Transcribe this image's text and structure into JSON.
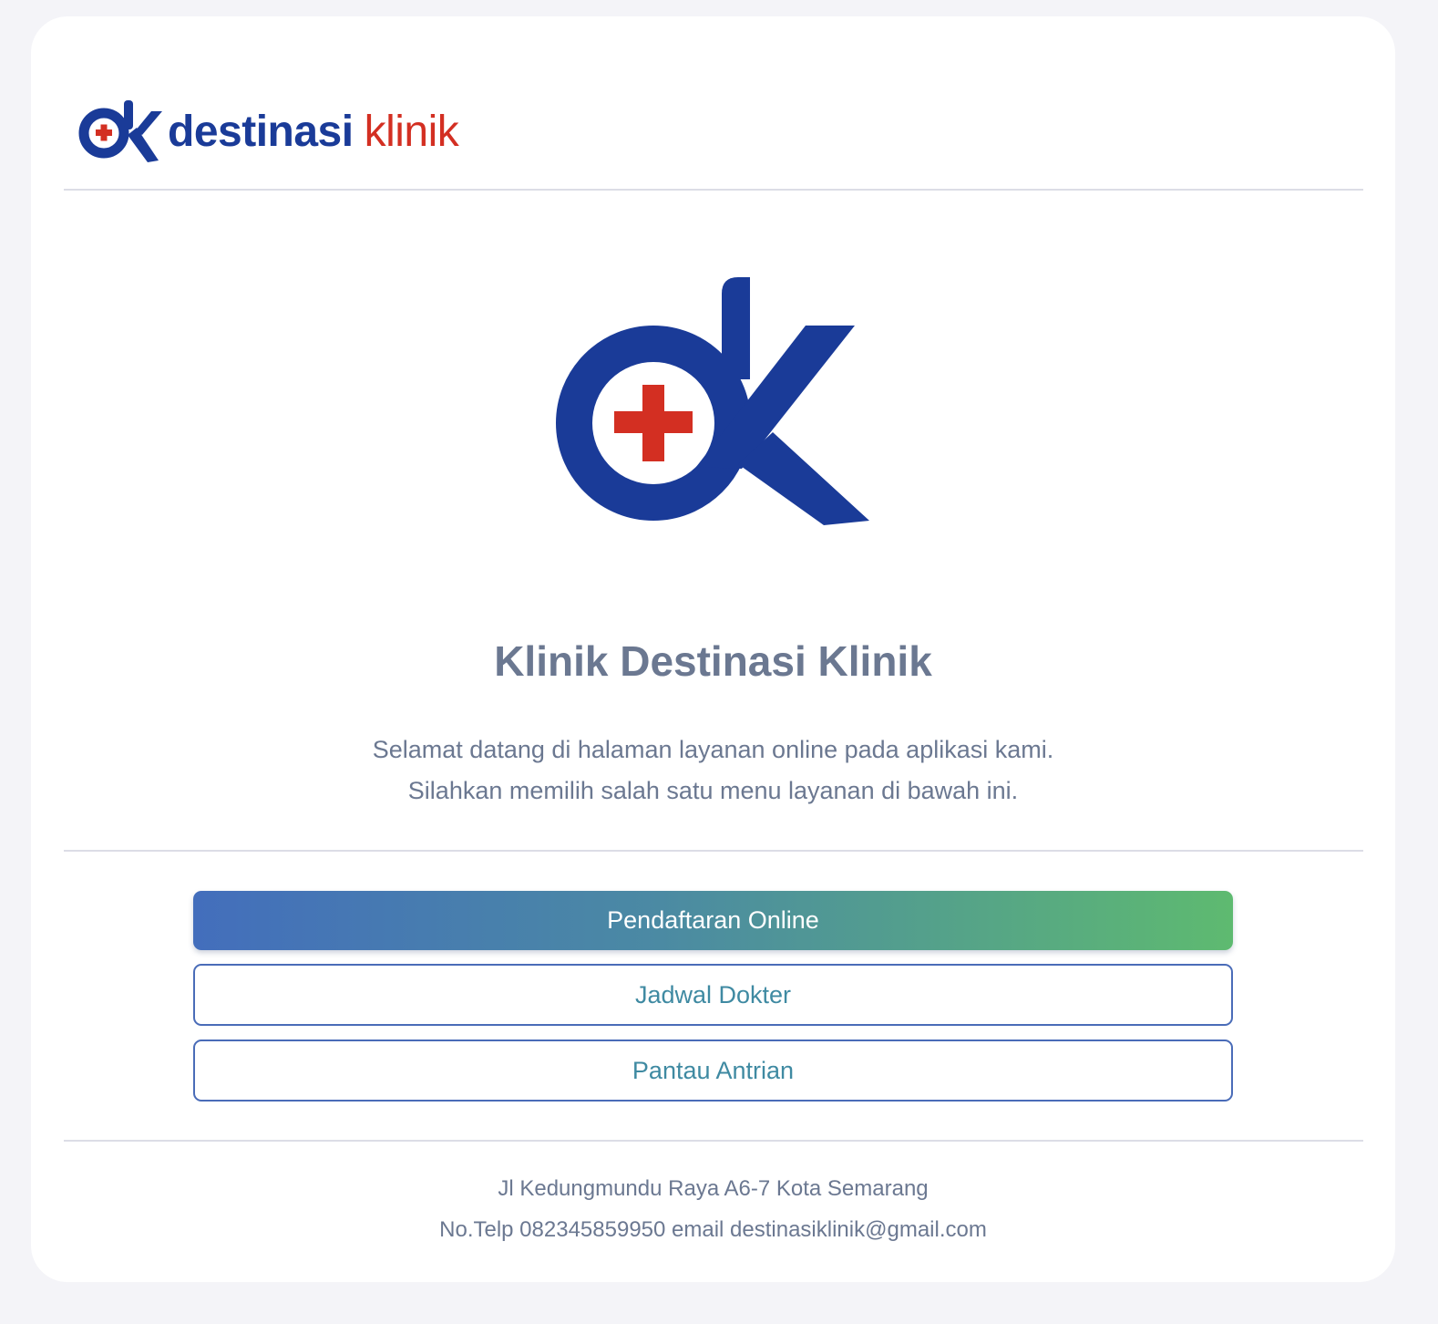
{
  "header": {
    "brand_word1": "destinasi",
    "brand_word2": "klinik"
  },
  "hero": {
    "clinic_name": "Klinik Destinasi Klinik",
    "welcome_line1": "Selamat datang di halaman layanan online pada aplikasi kami.",
    "welcome_line2": "Silahkan memilih salah satu menu layanan di bawah ini."
  },
  "menu": {
    "pendaftaran_label": "Pendaftaran Online",
    "jadwal_label": "Jadwal Dokter",
    "pantau_label": "Pantau Antrian"
  },
  "footer": {
    "address": "Jl Kedungmundu Raya A6-7 Kota Semarang",
    "contact": "No.Telp 082345859950 email destinasiklinik@gmail.com"
  },
  "colors": {
    "brand_blue": "#1a3b98",
    "brand_red": "#d32f22",
    "text_gray": "#6b7891",
    "button_gradient_start": "#436ebc",
    "button_gradient_end": "#5eba70",
    "outline_text": "#3f8aa2"
  },
  "icons": {
    "brand_logo": "dk-medical-cross-logo"
  }
}
